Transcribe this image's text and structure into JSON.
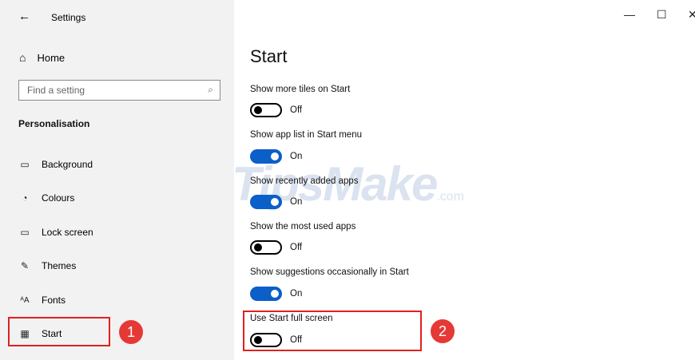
{
  "window": {
    "title": "Settings"
  },
  "icons": {
    "back": "←",
    "minimize": "—",
    "maximize": "☐",
    "close": "✕",
    "home": "⌂",
    "search": "⌕",
    "background": "▭",
    "colours": "◔",
    "lock_screen": "▭",
    "themes": "✎",
    "fonts": "ᴬA",
    "start": "▦"
  },
  "sidebar": {
    "home_label": "Home",
    "search_placeholder": "Find a setting",
    "section_heading": "Personalisation",
    "items": [
      {
        "label": "Background"
      },
      {
        "label": "Colours"
      },
      {
        "label": "Lock screen"
      },
      {
        "label": "Themes"
      },
      {
        "label": "Fonts"
      },
      {
        "label": "Start"
      }
    ]
  },
  "main": {
    "title": "Start",
    "options": [
      {
        "label": "Show more tiles on Start",
        "state": "Off"
      },
      {
        "label": "Show app list in Start menu",
        "state": "On"
      },
      {
        "label": "Show recently added apps",
        "state": "On"
      },
      {
        "label": "Show the most used apps",
        "state": "Off"
      },
      {
        "label": "Show suggestions occasionally in Start",
        "state": "On"
      },
      {
        "label": "Use Start full screen",
        "state": "Off"
      }
    ]
  },
  "annotations": {
    "badge1": "1",
    "badge2": "2"
  },
  "watermark": {
    "main": "TipsMake",
    "suffix": ".com"
  },
  "colors": {
    "accent": "#0a5fc8",
    "highlight": "#e02020",
    "badge": "#e53935"
  }
}
